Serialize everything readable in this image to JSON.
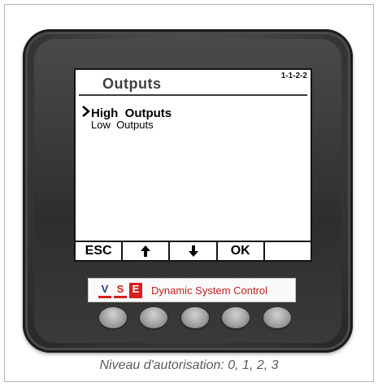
{
  "screen": {
    "title": "Outputs",
    "code": "1-1-2-2",
    "menu": [
      {
        "label": "High  Outputs",
        "selected": true
      },
      {
        "label": "Low  Outputs",
        "selected": false
      }
    ],
    "softkeys": [
      {
        "label": "ESC",
        "icon": ""
      },
      {
        "label": "",
        "icon": "arrow-up-icon"
      },
      {
        "label": "",
        "icon": "arrow-down-icon"
      },
      {
        "label": "OK",
        "icon": ""
      },
      {
        "label": "",
        "icon": ""
      }
    ]
  },
  "brand": {
    "logo_letters": [
      "V",
      "S",
      "E"
    ],
    "text": "Dynamic System Control",
    "color": "#c81e1e"
  },
  "caption": "Niveau d'autorisation: 0, 1, 2, 3"
}
